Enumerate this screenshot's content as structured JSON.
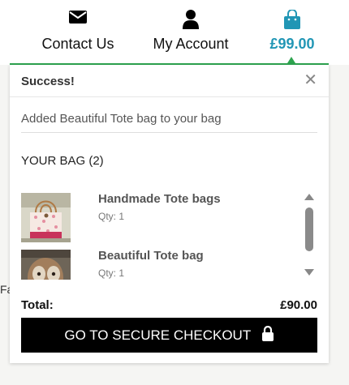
{
  "nav": {
    "contact": {
      "label": "Contact Us",
      "icon": "envelope-icon"
    },
    "account": {
      "label": "My Account",
      "icon": "user-icon"
    },
    "bag": {
      "total": "£99.00",
      "icon": "shopping-bag-icon",
      "color": "#2196b5"
    }
  },
  "page": {
    "fragment": "Fa"
  },
  "toast": {
    "title": "Success!",
    "message": "Added Beautiful Tote bag to your bag",
    "accent_color": "#2ea44f",
    "bag_heading": "YOUR BAG (2)",
    "items": [
      {
        "name": "Handmade Tote bags",
        "qty": "Qty: 1"
      },
      {
        "name": "Beautiful Tote bag",
        "qty": "Qty: 1"
      }
    ],
    "total_label": "Total:",
    "total_value": "£90.00",
    "checkout_label": "GO TO SECURE CHECKOUT"
  }
}
